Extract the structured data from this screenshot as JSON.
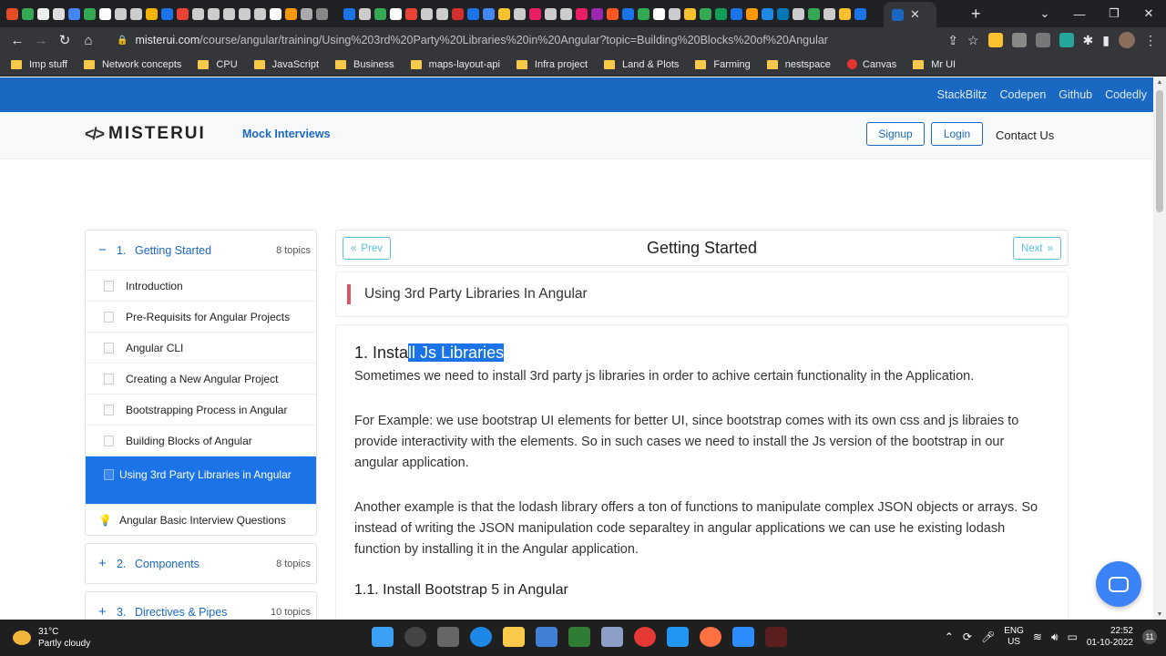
{
  "browser": {
    "url_host": "misterui.com",
    "url_path": "/course/angular/training/Using%203rd%20Party%20Libraries%20in%20Angular?topic=Building%20Blocks%20of%20Angular",
    "bookmarks": [
      "Imp stuff",
      "Network concepts",
      "CPU",
      "JavaScript",
      "Business",
      "maps-layout-api",
      "Infra project",
      "Land & Plots",
      "Farming",
      "nestspace",
      "Canvas",
      "Mr UI"
    ]
  },
  "topbar": {
    "links": [
      "StackBiltz",
      "Codepen",
      "Github",
      "Codedly"
    ]
  },
  "header": {
    "logo": "MISTERUI",
    "mock_interviews": "Mock Interviews",
    "signup": "Signup",
    "login": "Login",
    "contact": "Contact Us"
  },
  "sidebar": {
    "section1": {
      "sign": "−",
      "num": "1.",
      "title": "Getting Started",
      "count": "8 topics"
    },
    "topics": [
      "Introduction",
      "Pre-Requisits for Angular Projects",
      "Angular CLI",
      "Creating a New Angular Project",
      "Bootstrapping Process in Angular",
      "Building Blocks of Angular",
      "Using 3rd Party Libraries in Angular",
      "Angular Basic Interview Questions"
    ],
    "section2": {
      "sign": "+",
      "num": "2.",
      "title": "Components",
      "count": "8 topics"
    },
    "section3": {
      "sign": "+",
      "num": "3.",
      "title": "Directives & Pipes",
      "count": "10 topics"
    }
  },
  "main": {
    "prev": "Prev",
    "next": "Next",
    "page_title": "Getting Started",
    "lesson_title": "Using 3rd Party Libraries In Angular",
    "heading_plain": "1. Insta",
    "heading_selected": "ll Js Libraries",
    "para1": "Sometimes we need to install 3rd party js libraries in order to achive certain functionality in the Application.",
    "para2": "For Example: we use bootstrap UI elements for better UI, since bootstrap comes with its own css and js libraies to provide interactivity with the elements. So in such cases we need to install the Js version of the bootstrap in our angular application.",
    "para3": "Another example is that the lodash library offers a ton of functions to manipulate complex JSON objects or arrays. So instead of writing the JSON manipulation code separaltey in angular applications we can use he existing lodash function by installing it in the Angular application.",
    "subheading": "1.1. Install Bootstrap 5 in Angular"
  },
  "taskbar": {
    "temp": "31°C",
    "weather": "Partly cloudy",
    "lang1": "ENG",
    "lang2": "US",
    "time": "22:52",
    "date": "01-10-2022",
    "notif": "11"
  },
  "colors": {
    "brand_blue": "#1b68c3",
    "active_blue": "#1b73e8",
    "accent_red": "#e05566",
    "info": "#5bc0de"
  }
}
